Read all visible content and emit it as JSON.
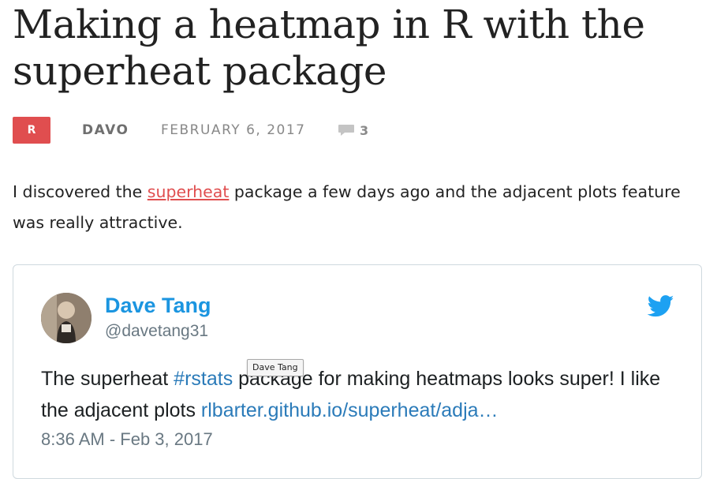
{
  "post": {
    "title": "Making a heatmap in R with the superheat package",
    "category": "R",
    "author": "DAVO",
    "date": "FEBRUARY 6, 2017",
    "comment_count": "3",
    "intro_prefix": "I discovered the ",
    "intro_link": "superheat",
    "intro_suffix": " package a few days ago and the adjacent plots feature was really attractive."
  },
  "tweet": {
    "name": "Dave Tang",
    "handle": "@davetang31",
    "text_part1": "The superheat ",
    "hashtag": "#rstats",
    "text_part2": " package for making heatmaps looks super! I like the adjacent plots ",
    "link": "rlbarter.github.io/superheat/adja…",
    "timestamp": "8:36 AM - Feb 3, 2017"
  },
  "tooltip": {
    "text": "Dave Tang"
  },
  "icons": {
    "comment": "comment-bubble-icon",
    "twitter": "twitter-bird-icon"
  },
  "colors": {
    "accent": "#e04e4f",
    "twitter_blue": "#1b95e0",
    "link_blue": "#2b7bb9",
    "muted": "#697882"
  }
}
